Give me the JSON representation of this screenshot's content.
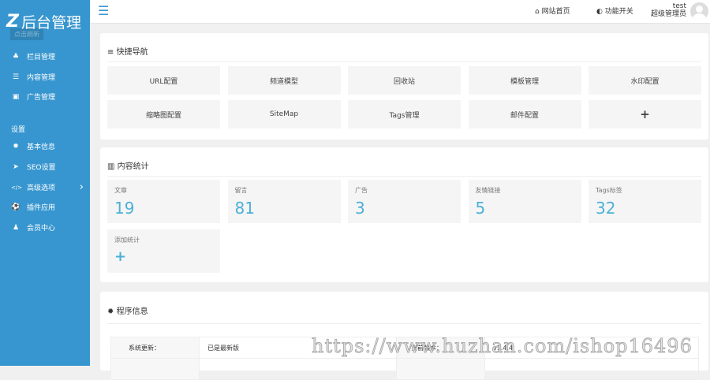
{
  "sidebar": {
    "logo_letter": "Z",
    "logo_text": "后台管理",
    "refresh": "点击刷新",
    "items": [
      {
        "icon": "sitemap-icon",
        "glyph": "♣",
        "label": "栏目管理"
      },
      {
        "icon": "list-icon",
        "glyph": "☰",
        "label": "内容管理"
      },
      {
        "icon": "image-icon",
        "glyph": "▣",
        "label": "广告管理"
      }
    ],
    "group_label": "设置",
    "settings": [
      {
        "icon": "gear-icon",
        "glyph": "✹",
        "label": "基本信息"
      },
      {
        "icon": "send-icon",
        "glyph": "➤",
        "label": "SEO设置"
      },
      {
        "icon": "code-icon",
        "glyph": "</>",
        "label": "高级选项",
        "chevron": "›"
      },
      {
        "icon": "soccer-icon",
        "glyph": "⚽",
        "label": "插件应用"
      },
      {
        "icon": "user-icon",
        "glyph": "♟",
        "label": "会员中心"
      }
    ]
  },
  "header": {
    "menu_glyph": "☰",
    "home": "网站首页",
    "home_glyph": "⌂",
    "toggle": "功能开关",
    "toggle_glyph": "◐",
    "username": "test",
    "role": "超级管理员"
  },
  "quicknav": {
    "title": "快捷导航",
    "title_glyph": "≡",
    "buttons": [
      "URL配置",
      "频道模型",
      "回收站",
      "模板管理",
      "水印配置",
      "缩略图配置",
      "SiteMap",
      "Tags管理",
      "邮件配置",
      "+"
    ]
  },
  "stats": {
    "title": "内容统计",
    "title_glyph": "▥",
    "items": [
      {
        "label": "文章",
        "value": "19"
      },
      {
        "label": "留言",
        "value": "81"
      },
      {
        "label": "广告",
        "value": "3"
      },
      {
        "label": "友情链接",
        "value": "5"
      },
      {
        "label": "Tags标签",
        "value": "32"
      }
    ],
    "add_label": "添加统计",
    "add_glyph": "+"
  },
  "info": {
    "title": "程序信息",
    "title_glyph": "✹",
    "rows": [
      {
        "k1": "系统更新：",
        "v1": "已是最新版",
        "k2": "当前版本：",
        "v2": "v1.4.4"
      }
    ]
  },
  "watermark": "https://www.huzhan.com/ishop16496",
  "colors": {
    "sidebar": "#3796cf",
    "accent": "#4bb0d8"
  }
}
